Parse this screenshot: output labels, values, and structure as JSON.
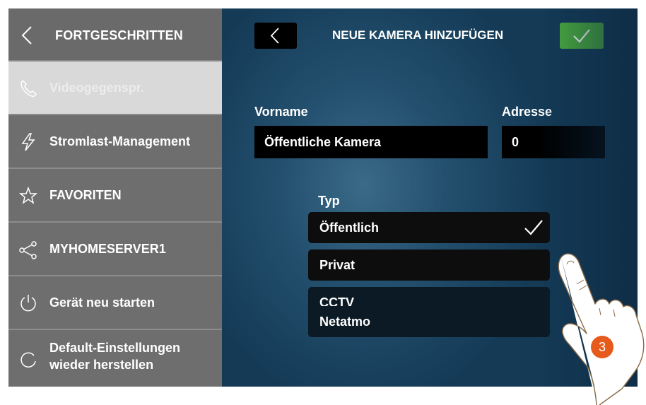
{
  "sidebar": {
    "title": "FORTGESCHRITTEN",
    "items": [
      {
        "label": "Videogegenspr.",
        "icon": "phone-icon",
        "active": true
      },
      {
        "label": "Stromlast-Management",
        "icon": "lightning-icon"
      },
      {
        "label": "FAVORITEN",
        "icon": "star-icon"
      },
      {
        "label": "MYHOMESERVER1",
        "icon": "share-icon"
      },
      {
        "label": "Gerät neu starten",
        "icon": "power-icon"
      },
      {
        "label_line1": "Default-Einstellungen",
        "label_line2": "wieder herstellen",
        "icon": "reset-icon"
      }
    ]
  },
  "header": {
    "title": "NEUE KAMERA HINZUFÜGEN",
    "back_icon": "chevron-left-icon",
    "confirm_icon": "checkmark-icon"
  },
  "form": {
    "name_label": "Vorname",
    "name_value": "Öffentliche Kamera",
    "address_label": "Adresse",
    "address_value": "0",
    "type_label": "Typ",
    "type_options": [
      {
        "label": "Öffentlich",
        "selected": true
      },
      {
        "label": "Privat"
      },
      {
        "label": "CCTV"
      },
      {
        "label": "Netatmo"
      }
    ]
  },
  "step_badge": "3",
  "colors": {
    "confirm": "#4caf3e",
    "sidebar": "#6e6e6e",
    "active_item": "#d9d9d9",
    "badge": "#e65a1c"
  }
}
